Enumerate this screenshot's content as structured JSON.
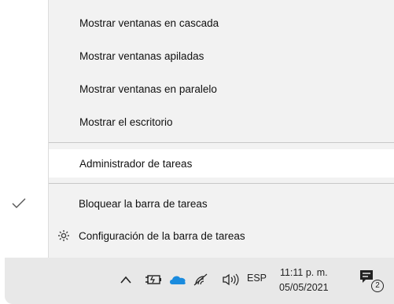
{
  "menu": {
    "items": [
      {
        "label": "Mostrar ventanas en cascada"
      },
      {
        "label": "Mostrar ventanas apiladas"
      },
      {
        "label": "Mostrar ventanas en paralelo"
      },
      {
        "label": "Mostrar el escritorio"
      },
      {
        "label": "Administrador de tareas"
      },
      {
        "label": "Bloquear la barra de tareas",
        "checked": true
      },
      {
        "label": "Configuración de la barra de tareas",
        "icon": "gear-icon"
      }
    ]
  },
  "taskbar": {
    "tray_icons": [
      "chevron-up-icon",
      "battery-charging-icon",
      "onedrive-cloud-icon",
      "wifi-icon",
      "speaker-icon"
    ],
    "language": "ESP",
    "time": "11:11 p. m.",
    "date": "05/05/2021",
    "notification_count": "2",
    "accent_color": "#1a8bde"
  }
}
